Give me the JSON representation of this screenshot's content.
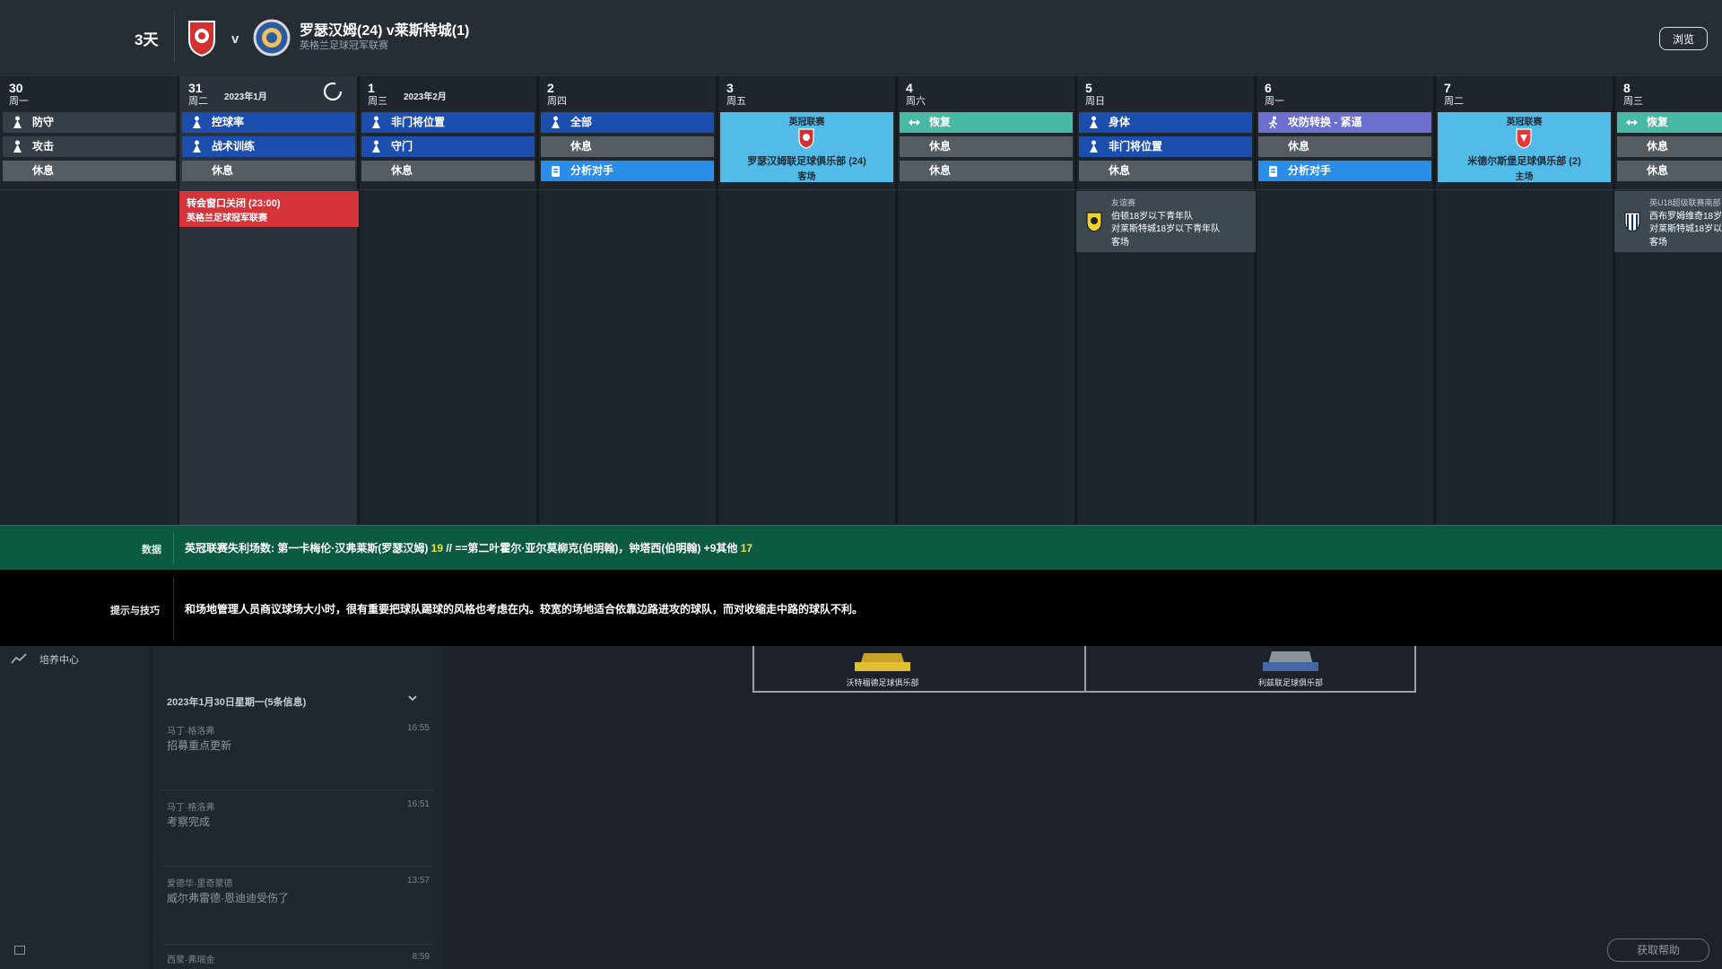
{
  "header": {
    "countdown": "3天",
    "vs": "v",
    "match_title": "罗瑟汉姆(24) v莱斯特城(1)",
    "competition": "英格兰足球冠军联赛",
    "browse_label": "浏览",
    "home_crest": "rotherham-crest",
    "away_crest": "leicester-crest"
  },
  "days": [
    {
      "num": "30",
      "week": "周一"
    },
    {
      "num": "31",
      "week": "周二",
      "month": "2023年1月"
    },
    {
      "num": "1",
      "week": "周三",
      "month": "2023年2月"
    },
    {
      "num": "2",
      "week": "周四"
    },
    {
      "num": "3",
      "week": "周五"
    },
    {
      "num": "4",
      "week": "周六"
    },
    {
      "num": "5",
      "week": "周日"
    },
    {
      "num": "6",
      "week": "周一"
    },
    {
      "num": "7",
      "week": "周二"
    },
    {
      "num": "8",
      "week": "周三"
    }
  ],
  "sessions": {
    "d30": [
      "防守",
      "攻击",
      "休息"
    ],
    "d31": [
      "控球率",
      "战术训练",
      "休息"
    ],
    "d1": [
      "非门将位置",
      "守门",
      "休息"
    ],
    "d2": [
      "全部",
      "休息",
      "分析对手"
    ],
    "d4": [
      "恢复",
      "休息",
      "休息"
    ],
    "d5": [
      "身体",
      "非门将位置",
      "休息"
    ],
    "d6": [
      "攻防转换 - 紧逼",
      "休息",
      "分析对手"
    ],
    "d8": [
      "恢复",
      "休息",
      "休息"
    ]
  },
  "matches": {
    "d3": {
      "competition": "英冠联赛",
      "opponent": "罗瑟汉姆联足球俱乐部 (24)",
      "venue": "客场"
    },
    "d7": {
      "competition": "英冠联赛",
      "opponent": "米德尔斯堡足球俱乐部 (2)",
      "venue": "主场"
    }
  },
  "events": {
    "transfer": {
      "title": "转会窗口关闭 (23:00)",
      "subtitle": "英格兰足球冠军联赛"
    },
    "friendly": {
      "type": "友谊赛",
      "line1": "伯顿18岁以下青年队",
      "line2": "对莱斯特城18岁以下青年队",
      "venue": "客场"
    },
    "u18": {
      "type": "英U18超级联赛南部",
      "line1": "西布罗姆维奇18岁",
      "line2": "对莱斯特城18岁以",
      "venue": "客场"
    }
  },
  "stats": {
    "label": "数据",
    "text_a": "英冠联赛失利场数: 第一卡梅伦·汉弗莱斯(罗瑟汉姆) ",
    "num_a": "19",
    "text_b": " // ==第二叶霍尔·亚尔莫柳克(伯明翰)，钟塔西(伯明翰) +9其他 ",
    "num_b": "17"
  },
  "tips": {
    "label": "提示与技巧",
    "text": "和场地管理人员商议球场大小时，很有重要把球队踢球的风格也考虑在内。较宽的场地适合依靠边路进攻的球队，而对收缩走中路的球队不利。"
  },
  "left_rail": {
    "label": "培养中心"
  },
  "inbox": {
    "date": "2023年1月30日星期一(5条信息)",
    "messages": [
      {
        "from": "马丁·格洛弗",
        "time": "16:55",
        "subject": "招募重点更新"
      },
      {
        "from": "马丁·格洛弗",
        "time": "16:51",
        "subject": "考察完成"
      },
      {
        "from": "爱德华·里奇蒙德",
        "time": "13:57",
        "subject": "威尔弗雷德·恩迪迪受伤了"
      },
      {
        "from": "西蒙·弗瑞金",
        "time": "8:59",
        "subject": ""
      }
    ]
  },
  "pitch": {
    "left_club": "沃特福德足球俱乐部",
    "right_club": "利兹联足球俱乐部"
  },
  "watermark": "获取帮助",
  "colors": {
    "training_blue": "#1c4fad",
    "rest_grey": "#555c62",
    "recovery_green": "#47b9a4",
    "match_cyan": "#52bbe8",
    "alert_red": "#d5343b",
    "stats_green": "#0d5a43",
    "highlight_yellow": "#f2e03a"
  }
}
